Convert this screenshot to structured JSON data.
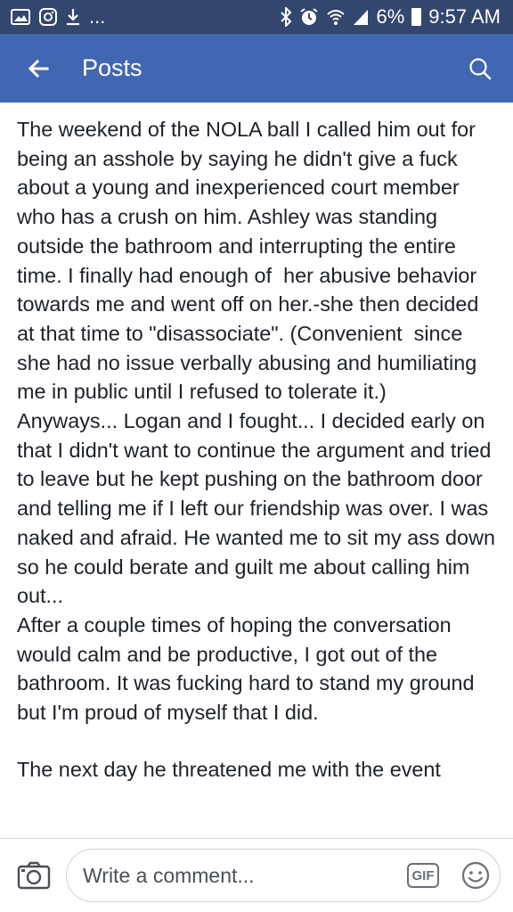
{
  "status_bar": {
    "left_icons": [
      "image-icon",
      "instagram-icon",
      "download-icon"
    ],
    "overflow": "...",
    "right_icons": [
      "bluetooth-icon",
      "alarm-icon",
      "wifi-icon",
      "signal-icon"
    ],
    "battery": "6%",
    "time": "9:57 AM"
  },
  "app_bar": {
    "back_icon": "back-arrow-icon",
    "title": "Posts",
    "search_icon": "search-icon"
  },
  "post": {
    "paragraph_1": "The weekend of the NOLA ball I called him out for being an asshole by saying he didn't give a fuck about a young and inexperienced court member who has a crush on him. Ashley was standing outside the bathroom and interrupting the entire time. I finally had enough of  her abusive behavior towards me and went off on her.-she then decided at that time to \"disassociate\". (Convenient  since she had no issue verbally abusing and humiliating me in public until I refused to tolerate it.)\nAnyways... Logan and I fought... I decided early on that I didn't want to continue the argument and tried to leave but he kept pushing on the bathroom door and telling me if I left our friendship was over. I was naked and afraid. He wanted me to sit my ass down so he could berate and guilt me about calling him out...\nAfter a couple times of hoping the conversation would calm and be productive, I got out of the bathroom. It was fucking hard to stand my ground but I'm proud of myself that I did.",
    "paragraph_2": "The next day he threatened me with the event"
  },
  "comment_bar": {
    "camera_icon": "camera-icon",
    "placeholder": "Write a comment...",
    "gif_label": "GIF",
    "emoji_icon": "smiley-icon"
  },
  "colors": {
    "status_bar": "#33466e",
    "app_bar": "#4267b2",
    "text": "#1d2129"
  }
}
